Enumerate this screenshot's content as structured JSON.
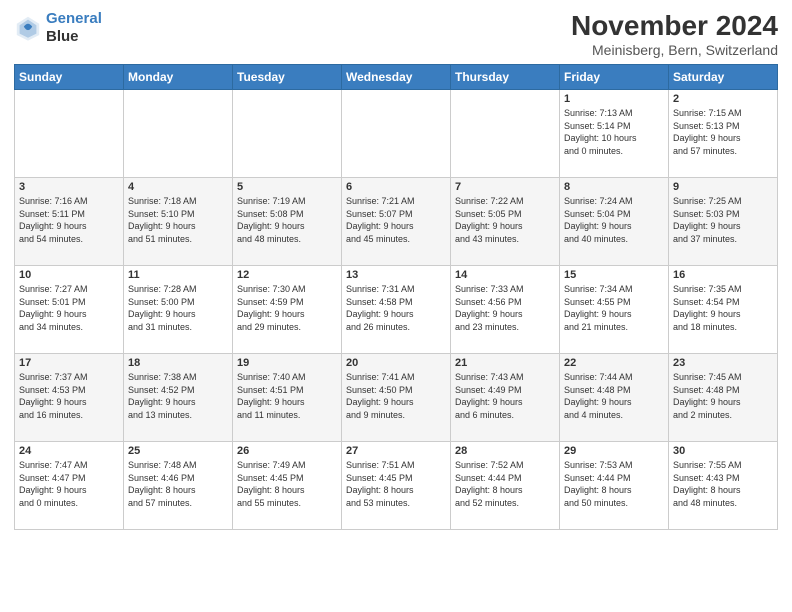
{
  "header": {
    "logo_line1": "General",
    "logo_line2": "Blue",
    "title": "November 2024",
    "location": "Meinisberg, Bern, Switzerland"
  },
  "weekdays": [
    "Sunday",
    "Monday",
    "Tuesday",
    "Wednesday",
    "Thursday",
    "Friday",
    "Saturday"
  ],
  "weeks": [
    [
      {
        "day": "",
        "info": ""
      },
      {
        "day": "",
        "info": ""
      },
      {
        "day": "",
        "info": ""
      },
      {
        "day": "",
        "info": ""
      },
      {
        "day": "",
        "info": ""
      },
      {
        "day": "1",
        "info": "Sunrise: 7:13 AM\nSunset: 5:14 PM\nDaylight: 10 hours\nand 0 minutes."
      },
      {
        "day": "2",
        "info": "Sunrise: 7:15 AM\nSunset: 5:13 PM\nDaylight: 9 hours\nand 57 minutes."
      }
    ],
    [
      {
        "day": "3",
        "info": "Sunrise: 7:16 AM\nSunset: 5:11 PM\nDaylight: 9 hours\nand 54 minutes."
      },
      {
        "day": "4",
        "info": "Sunrise: 7:18 AM\nSunset: 5:10 PM\nDaylight: 9 hours\nand 51 minutes."
      },
      {
        "day": "5",
        "info": "Sunrise: 7:19 AM\nSunset: 5:08 PM\nDaylight: 9 hours\nand 48 minutes."
      },
      {
        "day": "6",
        "info": "Sunrise: 7:21 AM\nSunset: 5:07 PM\nDaylight: 9 hours\nand 45 minutes."
      },
      {
        "day": "7",
        "info": "Sunrise: 7:22 AM\nSunset: 5:05 PM\nDaylight: 9 hours\nand 43 minutes."
      },
      {
        "day": "8",
        "info": "Sunrise: 7:24 AM\nSunset: 5:04 PM\nDaylight: 9 hours\nand 40 minutes."
      },
      {
        "day": "9",
        "info": "Sunrise: 7:25 AM\nSunset: 5:03 PM\nDaylight: 9 hours\nand 37 minutes."
      }
    ],
    [
      {
        "day": "10",
        "info": "Sunrise: 7:27 AM\nSunset: 5:01 PM\nDaylight: 9 hours\nand 34 minutes."
      },
      {
        "day": "11",
        "info": "Sunrise: 7:28 AM\nSunset: 5:00 PM\nDaylight: 9 hours\nand 31 minutes."
      },
      {
        "day": "12",
        "info": "Sunrise: 7:30 AM\nSunset: 4:59 PM\nDaylight: 9 hours\nand 29 minutes."
      },
      {
        "day": "13",
        "info": "Sunrise: 7:31 AM\nSunset: 4:58 PM\nDaylight: 9 hours\nand 26 minutes."
      },
      {
        "day": "14",
        "info": "Sunrise: 7:33 AM\nSunset: 4:56 PM\nDaylight: 9 hours\nand 23 minutes."
      },
      {
        "day": "15",
        "info": "Sunrise: 7:34 AM\nSunset: 4:55 PM\nDaylight: 9 hours\nand 21 minutes."
      },
      {
        "day": "16",
        "info": "Sunrise: 7:35 AM\nSunset: 4:54 PM\nDaylight: 9 hours\nand 18 minutes."
      }
    ],
    [
      {
        "day": "17",
        "info": "Sunrise: 7:37 AM\nSunset: 4:53 PM\nDaylight: 9 hours\nand 16 minutes."
      },
      {
        "day": "18",
        "info": "Sunrise: 7:38 AM\nSunset: 4:52 PM\nDaylight: 9 hours\nand 13 minutes."
      },
      {
        "day": "19",
        "info": "Sunrise: 7:40 AM\nSunset: 4:51 PM\nDaylight: 9 hours\nand 11 minutes."
      },
      {
        "day": "20",
        "info": "Sunrise: 7:41 AM\nSunset: 4:50 PM\nDaylight: 9 hours\nand 9 minutes."
      },
      {
        "day": "21",
        "info": "Sunrise: 7:43 AM\nSunset: 4:49 PM\nDaylight: 9 hours\nand 6 minutes."
      },
      {
        "day": "22",
        "info": "Sunrise: 7:44 AM\nSunset: 4:48 PM\nDaylight: 9 hours\nand 4 minutes."
      },
      {
        "day": "23",
        "info": "Sunrise: 7:45 AM\nSunset: 4:48 PM\nDaylight: 9 hours\nand 2 minutes."
      }
    ],
    [
      {
        "day": "24",
        "info": "Sunrise: 7:47 AM\nSunset: 4:47 PM\nDaylight: 9 hours\nand 0 minutes."
      },
      {
        "day": "25",
        "info": "Sunrise: 7:48 AM\nSunset: 4:46 PM\nDaylight: 8 hours\nand 57 minutes."
      },
      {
        "day": "26",
        "info": "Sunrise: 7:49 AM\nSunset: 4:45 PM\nDaylight: 8 hours\nand 55 minutes."
      },
      {
        "day": "27",
        "info": "Sunrise: 7:51 AM\nSunset: 4:45 PM\nDaylight: 8 hours\nand 53 minutes."
      },
      {
        "day": "28",
        "info": "Sunrise: 7:52 AM\nSunset: 4:44 PM\nDaylight: 8 hours\nand 52 minutes."
      },
      {
        "day": "29",
        "info": "Sunrise: 7:53 AM\nSunset: 4:44 PM\nDaylight: 8 hours\nand 50 minutes."
      },
      {
        "day": "30",
        "info": "Sunrise: 7:55 AM\nSunset: 4:43 PM\nDaylight: 8 hours\nand 48 minutes."
      }
    ]
  ]
}
